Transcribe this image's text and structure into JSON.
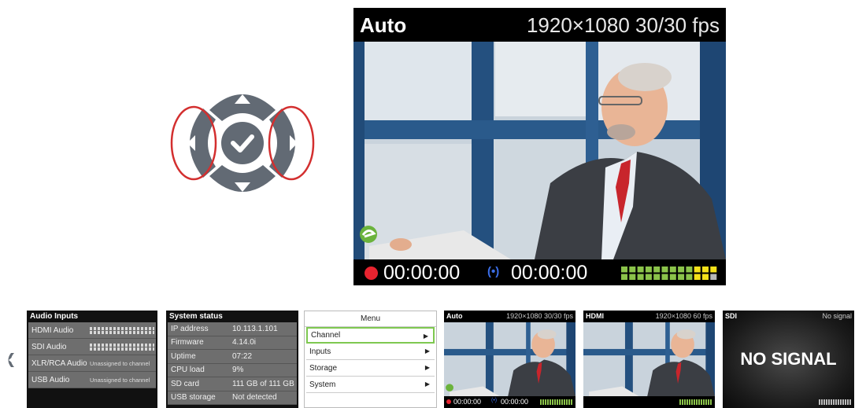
{
  "main_display": {
    "input_name": "Auto",
    "resolution": "1920×1080 30/30 fps",
    "record_time": "00:00:00",
    "stream_time": "00:00:00",
    "stream_icon": "(•)"
  },
  "audio_inputs": {
    "title": "Audio Inputs",
    "rows": [
      {
        "label": "HDMI Audio",
        "value": ""
      },
      {
        "label": "SDI Audio",
        "value": ""
      },
      {
        "label": "XLR/RCA Audio",
        "value": "Unassigned to channel"
      },
      {
        "label": "USB Audio",
        "value": "Unassigned to channel"
      }
    ]
  },
  "system_status": {
    "title": "System status",
    "rows": [
      {
        "label": "IP address",
        "value": "10.113.1.101"
      },
      {
        "label": "Firmware",
        "value": "4.14.0i"
      },
      {
        "label": "Uptime",
        "value": "07:22"
      },
      {
        "label": "CPU load",
        "value": "9%"
      },
      {
        "label": "SD card",
        "value": "111 GB of 111 GB"
      },
      {
        "label": "USB storage",
        "value": "Not detected"
      }
    ]
  },
  "menu": {
    "title": "Menu",
    "items": [
      {
        "label": "Channel",
        "selected": true
      },
      {
        "label": "Inputs",
        "selected": false
      },
      {
        "label": "Storage",
        "selected": false
      },
      {
        "label": "System",
        "selected": false
      }
    ]
  },
  "thumbs": [
    {
      "name": "Auto",
      "resolution": "1920×1080 30/30 fps",
      "record_time": "00:00:00",
      "stream_time": "00:00:00"
    },
    {
      "name": "HDMI",
      "resolution": "1920×1080 60 fps"
    },
    {
      "name": "SDI",
      "resolution": "No signal",
      "message": "NO SIGNAL"
    }
  ],
  "colors": {
    "record": "#e8232f",
    "stream": "#3b6ee8",
    "meter_green": "#8bc34a",
    "meter_yellow": "#f5e11a",
    "menu_highlight": "#7ec850",
    "dpad": "#636b75",
    "dpad_highlight": "#d32f2f"
  }
}
